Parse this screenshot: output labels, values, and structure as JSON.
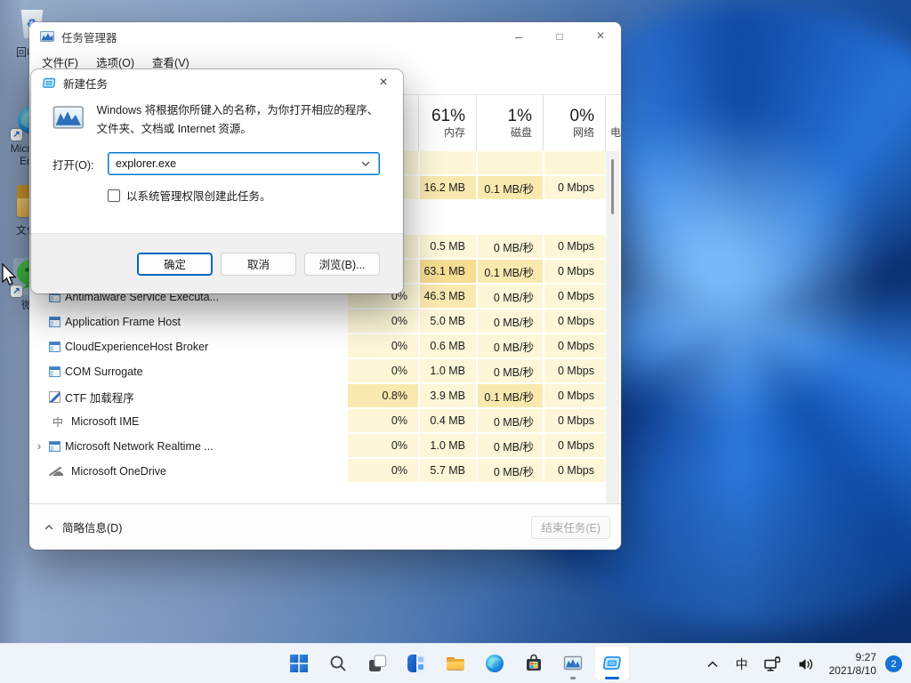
{
  "desktop": {
    "icons": [
      {
        "label": "回收站"
      },
      {
        "label": "Microsoft Edge"
      },
      {
        "label": "文件夹"
      },
      {
        "label": "微信"
      }
    ]
  },
  "task_manager": {
    "window_title": "任务管理器",
    "menu": [
      "文件(F)",
      "选项(O)",
      "查看(V)"
    ],
    "header": {
      "memory_pct": "61%",
      "memory_label": "内存",
      "disk_pct": "1%",
      "disk_label": "磁盘",
      "network_pct": "0%",
      "network_label": "网络",
      "power_label": "电"
    },
    "rows": [
      {
        "name": "",
        "icon": "",
        "cpu": "",
        "mem": "",
        "disk": "",
        "net": ""
      },
      {
        "name": "",
        "icon": "",
        "cpu": "",
        "mem": "16.2 MB",
        "disk": "0.1 MB/秒",
        "net": "0 Mbps"
      },
      {
        "name": "",
        "icon": "",
        "cpu": "",
        "mem": "",
        "disk": "",
        "net": "",
        "group": true
      },
      {
        "name": "",
        "icon": "",
        "cpu": "",
        "mem": "0.5 MB",
        "disk": "0 MB/秒",
        "net": "0 Mbps"
      },
      {
        "name": "",
        "icon": "",
        "cpu": "",
        "mem": "63.1 MB",
        "disk": "0.1 MB/秒",
        "net": "0 Mbps"
      },
      {
        "name": "Antimalware Service Executa...",
        "icon": "app",
        "cpu": "0%",
        "mem": "46.3 MB",
        "disk": "0 MB/秒",
        "net": "0 Mbps"
      },
      {
        "name": "Application Frame Host",
        "icon": "app",
        "cpu": "0%",
        "mem": "5.0 MB",
        "disk": "0 MB/秒",
        "net": "0 Mbps"
      },
      {
        "name": "CloudExperienceHost Broker",
        "icon": "app",
        "cpu": "0%",
        "mem": "0.6 MB",
        "disk": "0 MB/秒",
        "net": "0 Mbps"
      },
      {
        "name": "COM Surrogate",
        "icon": "app",
        "cpu": "0%",
        "mem": "1.0 MB",
        "disk": "0 MB/秒",
        "net": "0 Mbps"
      },
      {
        "name": "CTF 加载程序",
        "icon": "pen",
        "cpu": "0.8%",
        "mem": "3.9 MB",
        "disk": "0.1 MB/秒",
        "net": "0 Mbps"
      },
      {
        "name": "Microsoft IME",
        "icon": "ime",
        "cpu": "0%",
        "mem": "0.4 MB",
        "disk": "0 MB/秒",
        "net": "0 Mbps"
      },
      {
        "name": "Microsoft Network Realtime ...",
        "icon": "app",
        "cpu": "0%",
        "mem": "1.0 MB",
        "disk": "0 MB/秒",
        "net": "0 Mbps",
        "expand": true
      },
      {
        "name": "Microsoft OneDrive",
        "icon": "cloud",
        "cpu": "0%",
        "mem": "5.7 MB",
        "disk": "0 MB/秒",
        "net": "0 Mbps"
      }
    ],
    "footer": {
      "toggle_label": "简略信息(D)",
      "end_task_label": "结束任务(E)"
    }
  },
  "dialog": {
    "title": "新建任务",
    "description": "Windows 将根据你所键入的名称，为你打开相应的程序、文件夹、文档或 Internet 资源。",
    "open_label": "打开(O):",
    "open_value": "explorer.exe",
    "admin_checkbox_label": "以系统管理权限创建此任务。",
    "ok_label": "确定",
    "cancel_label": "取消",
    "browse_label": "浏览(B)..."
  },
  "taskbar": {
    "buttons": [
      "start",
      "search",
      "task-view",
      "widgets",
      "file-explorer",
      "edge",
      "store",
      "task-manager",
      "new-task-dialog"
    ],
    "tray": {
      "ime_indicator": "中",
      "time": "9:27",
      "date": "2021/8/10",
      "badge_count": "2"
    }
  },
  "colors": {
    "accent": "#0b67d8",
    "heat_low": "#fdf7d8",
    "heat_mid": "#fae9af",
    "heat_high": "#f6dd92"
  }
}
